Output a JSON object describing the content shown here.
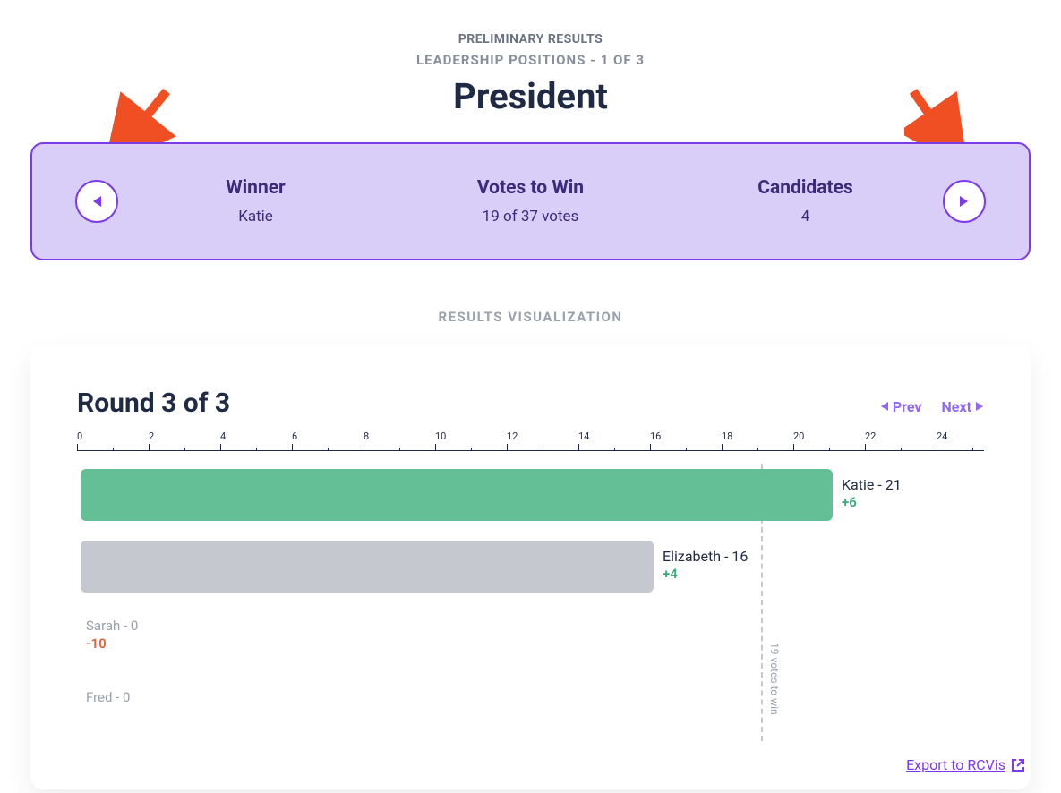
{
  "header": {
    "preliminary": "PRELIMINARY RESULTS",
    "subtitle": "LEADERSHIP POSITIONS - 1 OF 3",
    "title": "President"
  },
  "summary": {
    "cols": [
      {
        "heading": "Winner",
        "value": "Katie"
      },
      {
        "heading": "Votes to Win",
        "value": "19 of 37 votes"
      },
      {
        "heading": "Candidates",
        "value": "4"
      }
    ]
  },
  "viz": {
    "section_label": "RESULTS VISUALIZATION",
    "round_title": "Round 3 of 3",
    "prev_label": "Prev",
    "next_label": "Next",
    "threshold_label": "19 votes to win",
    "export_label": "Export to RCVis"
  },
  "chart_data": {
    "type": "bar",
    "x_axis": {
      "min": 0,
      "max": 25,
      "major_step": 2
    },
    "threshold": 19,
    "bars": [
      {
        "name": "Katie",
        "value": 21,
        "delta": "+6",
        "delta_sign": "pos",
        "color": "green",
        "label": "Katie - 21"
      },
      {
        "name": "Elizabeth",
        "value": 16,
        "delta": "+4",
        "delta_sign": "pos",
        "color": "gray",
        "label": "Elizabeth - 16"
      },
      {
        "name": "Sarah",
        "value": 0,
        "delta": "-10",
        "delta_sign": "neg",
        "color": "none",
        "label": "Sarah - 0"
      },
      {
        "name": "Fred",
        "value": 0,
        "delta": "",
        "delta_sign": "",
        "color": "none",
        "label": "Fred - 0"
      }
    ]
  },
  "colors": {
    "accent": "#7c3aed",
    "green": "#64bf97",
    "gray": "#c6c8d0",
    "delta_pos": "#3aa87a",
    "delta_neg": "#e8613c",
    "arrow": "#f04e23"
  }
}
